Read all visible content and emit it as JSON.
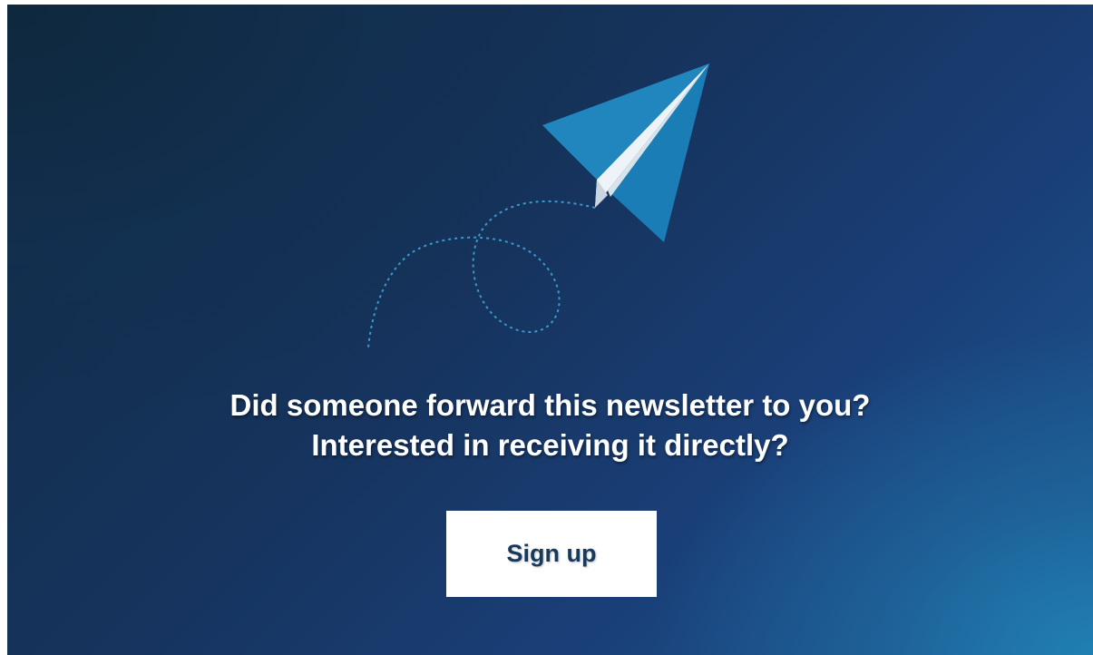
{
  "banner": {
    "headline_line1": "Did someone forward this newsletter to you?",
    "headline_line2": "Interested in receiving it directly?",
    "signup_label": "Sign up"
  },
  "colors": {
    "background_dark": "#112a42",
    "background_light": "#1d5a92",
    "plane_blue": "#1f87c1",
    "plane_white": "#eef3f7",
    "button_text": "#173a5c"
  },
  "icons": [
    "paper-plane-icon",
    "dotted-flight-path"
  ]
}
